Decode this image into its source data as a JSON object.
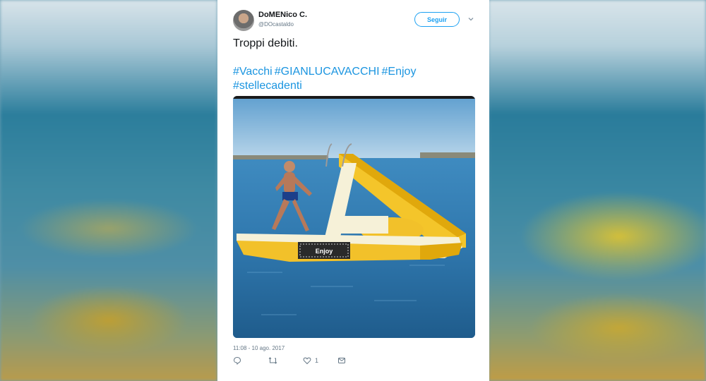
{
  "user": {
    "display_name": "DoMENico C.",
    "handle": "@DOcastaldo"
  },
  "follow_label": "Seguir",
  "tweet": {
    "text": "Troppi debiti.",
    "hashtags": [
      "#Vacchi",
      "#GIANLUCAVACCHI",
      "#Enjoy",
      "#stellecadenti"
    ]
  },
  "media": {
    "overlay_label": "Enjoy"
  },
  "timestamp": "11:08 - 10 ago. 2017",
  "actions": {
    "reply_icon": "reply-icon",
    "retweet_icon": "retweet-icon",
    "like_icon": "heart-icon",
    "like_count": "1",
    "dm_icon": "envelope-icon"
  },
  "colors": {
    "accent": "#1da1f2",
    "hashtag": "#1b95e0",
    "text": "#14171a",
    "muted": "#657786"
  }
}
